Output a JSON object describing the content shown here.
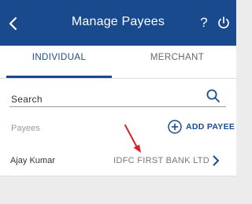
{
  "header": {
    "title": "Manage Payees",
    "help_label": "?",
    "icons": {
      "back": "chevron-left-icon",
      "power": "power-icon"
    },
    "colors": {
      "background": "#1a4a8e",
      "text": "#ffffff"
    }
  },
  "tabs": [
    {
      "label": "INDIVIDUAL",
      "active": true
    },
    {
      "label": "MERCHANT",
      "active": false
    }
  ],
  "search": {
    "label": "Search",
    "icon": "search-icon"
  },
  "payees_section": {
    "label": "Payees",
    "add_button_label": "ADD PAYEE",
    "add_icon": "plus-circle-icon",
    "annotation_color": "#e02020"
  },
  "payees": [
    {
      "name": "Ajay Kumar",
      "bank": "IDFC FIRST BANK LTD"
    }
  ]
}
